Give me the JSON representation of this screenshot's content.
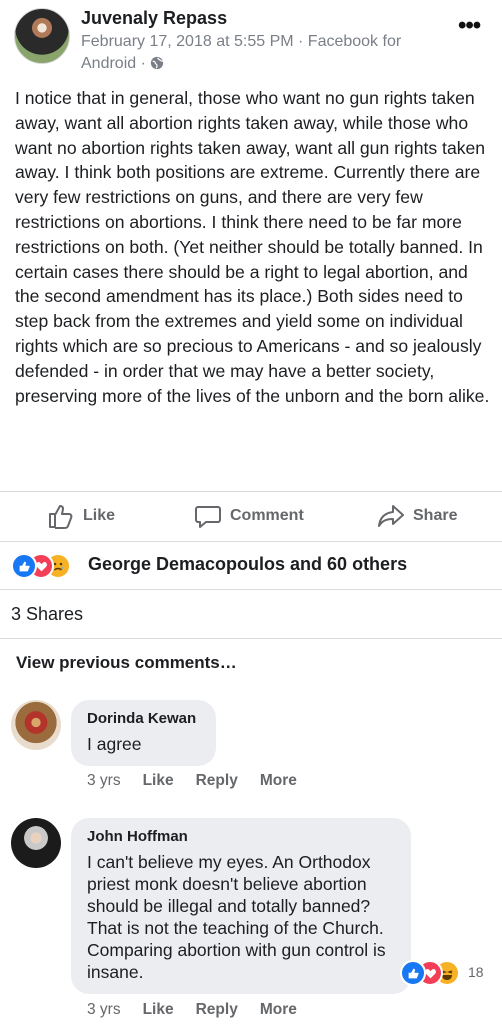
{
  "post": {
    "author": "Juvenaly Repass",
    "meta_line1": "February 17, 2018 at 5:55 PM · Facebook for",
    "meta_line2": "Android ·",
    "privacy_icon": "globe-icon",
    "more_icon": "more-dots-icon",
    "body": "I notice that in general, those who want no gun rights taken away, want all abortion rights taken away, while those who want no abortion rights taken away, want all gun rights taken away. I think both positions are extreme. Currently there are very few restrictions on guns, and there are very few restrictions on abortions. I think there need to be far more restrictions on both. (Yet neither should be totally banned. In certain cases there should be a right to legal abortion, and the second amendment has its place.) Both sides need to step back from the extremes and yield some on individual rights which are so precious to Americans - and so jealously defended - in order that we may have a better society, preserving more of the lives of the unborn and the born alike."
  },
  "actions": {
    "like": "Like",
    "comment": "Comment",
    "share": "Share"
  },
  "reactions": {
    "icons": [
      "like-reaction-icon",
      "love-reaction-icon",
      "sad-reaction-icon"
    ],
    "summary": "George Demacopoulos and 60 others"
  },
  "shares": "3 Shares",
  "view_previous": "View previous comments…",
  "comments": [
    {
      "author": "Dorinda Kewan",
      "text": "I agree",
      "time": "3 yrs",
      "like": "Like",
      "reply": "Reply",
      "more": "More"
    },
    {
      "author": "John Hoffman",
      "text": "I can't believe my eyes. An Orthodox priest monk doesn't believe abortion should be illegal and totally banned? That is not the teaching of the Church. Comparing abortion with gun control is insane.",
      "time": "3 yrs",
      "like": "Like",
      "reply": "Reply",
      "more": "More",
      "reaction_count": "18",
      "reaction_icons": [
        "like-reaction-icon",
        "love-reaction-icon",
        "haha-reaction-icon"
      ]
    }
  ],
  "colors": {
    "like_blue": "#1877f2",
    "love_red": "#f33e58",
    "yellow": "#f7b125",
    "muted": "#65676b"
  }
}
